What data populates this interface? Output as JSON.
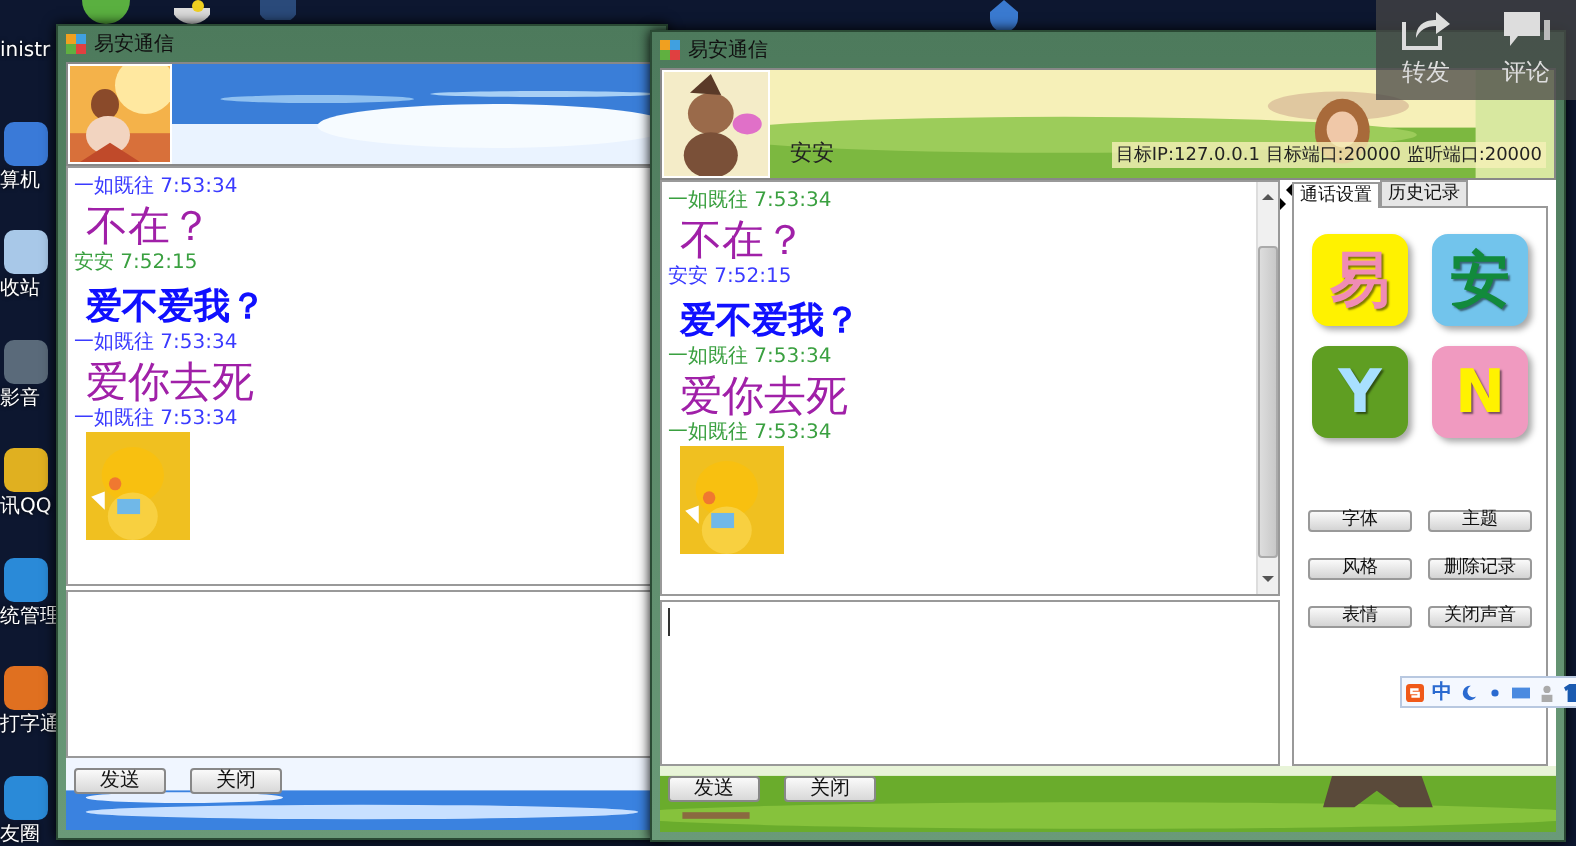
{
  "desktop": {
    "icons": [
      {
        "label": "inistr"
      },
      {
        "label": "算机"
      },
      {
        "label": "收站"
      },
      {
        "label": "影音"
      },
      {
        "label": "讯QQ"
      },
      {
        "label": "统管理"
      },
      {
        "label": "打字通"
      },
      {
        "label": "友圈"
      }
    ]
  },
  "windows": [
    {
      "title": "易安通信",
      "messages": [
        {
          "kind": "meta",
          "text": "一如既往 7:53:34",
          "color": "#3a3aff"
        },
        {
          "kind": "big",
          "text": "不在？",
          "color": "#a020a8"
        },
        {
          "kind": "meta",
          "text": "安安 7:52:15",
          "color": "#3aa040"
        },
        {
          "kind": "bold",
          "text": "爱不爱我？",
          "color": "#1010ff"
        },
        {
          "kind": "meta",
          "text": "一如既往 7:53:34",
          "color": "#3a3aff"
        },
        {
          "kind": "big",
          "text": "爱你去死",
          "color": "#a020a8"
        },
        {
          "kind": "meta",
          "text": "一如既往 7:53:34",
          "color": "#3a3aff"
        },
        {
          "kind": "sticker"
        }
      ],
      "buttons": [
        "发送",
        "关闭"
      ]
    },
    {
      "title": "易安通信",
      "name": "安安",
      "info": "目标IP:127.0.0.1  目标端口:20000  监听端口:20000",
      "messages": [
        {
          "kind": "meta",
          "text": "一如既往 7:53:34",
          "color": "#3aa040"
        },
        {
          "kind": "big",
          "text": "不在？",
          "color": "#a020a8"
        },
        {
          "kind": "meta",
          "text": "安安 7:52:15",
          "color": "#3a3aff"
        },
        {
          "kind": "bold",
          "text": "爱不爱我？",
          "color": "#1010ff"
        },
        {
          "kind": "meta",
          "text": "一如既往 7:53:34",
          "color": "#3aa040"
        },
        {
          "kind": "big",
          "text": "爱你去死",
          "color": "#a020a8"
        },
        {
          "kind": "meta",
          "text": "一如既往 7:53:34",
          "color": "#3aa040"
        },
        {
          "kind": "sticker"
        }
      ],
      "tabs": [
        {
          "label": "通话设置",
          "selected": true
        },
        {
          "label": "历史记录",
          "selected": false
        }
      ],
      "tiles": [
        {
          "color": "#fff200",
          "letter": {
            "label": "易",
            "color": "#f08cb4"
          }
        },
        {
          "color": "#72c4ec",
          "letter": {
            "label": "安",
            "color": "#128a3c"
          }
        },
        {
          "color": "#5f9e22",
          "letter": {
            "label": "Y",
            "color": "#a8e0ff"
          }
        },
        {
          "color": "#f09ac0",
          "letter": {
            "label": "N",
            "color": "#fff200"
          }
        }
      ],
      "panel_buttons": [
        "字体",
        "主题",
        "风格",
        "删除记录",
        "表情",
        "关闭声音"
      ],
      "buttons": [
        "发送",
        "关闭"
      ]
    }
  ],
  "ime_toolbar": {
    "label": "中"
  },
  "share_overlay": {
    "buttons": [
      "转发",
      "评论"
    ]
  }
}
